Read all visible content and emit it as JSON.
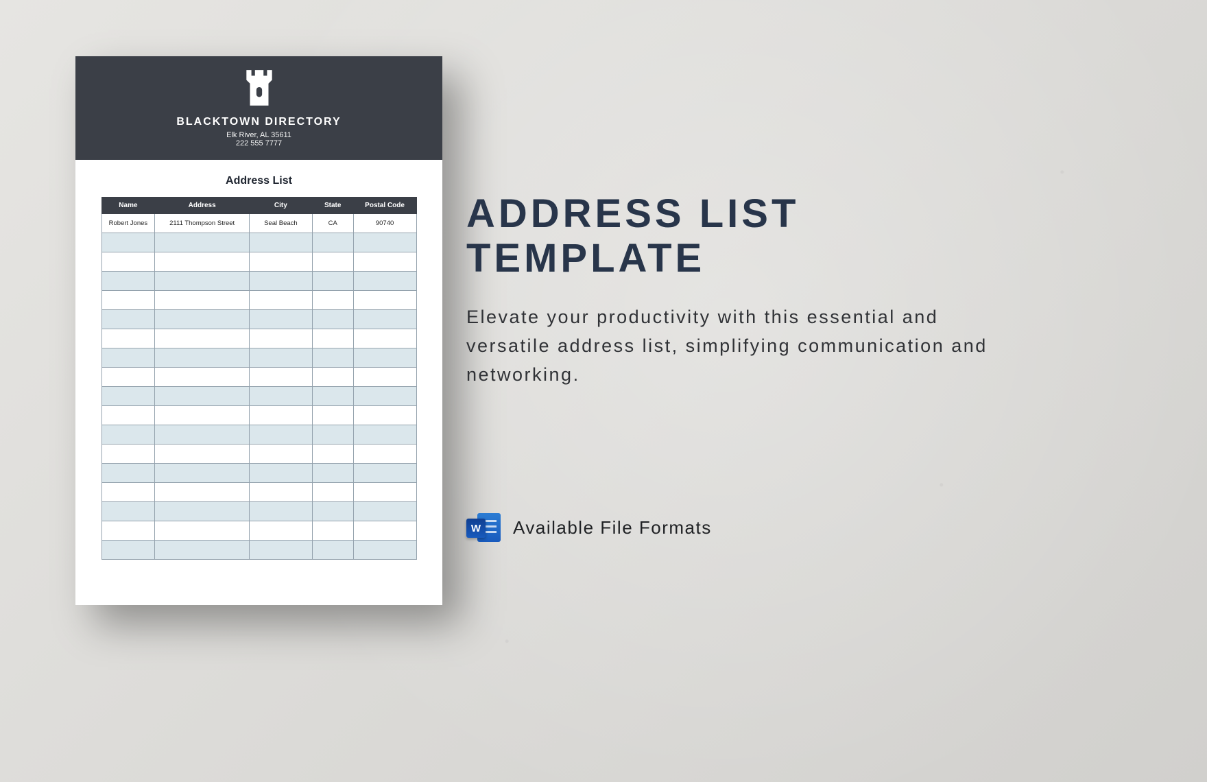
{
  "document": {
    "company": "BLACKTOWN DIRECTORY",
    "location": "Elk River, AL 35611",
    "phone": "222 555 7777",
    "list_title": "Address List",
    "columns": [
      "Name",
      "Address",
      "City",
      "State",
      "Postal Code"
    ],
    "rows": [
      {
        "name": "Robert Jones",
        "address": "2111 Thompson Street",
        "city": "Seal Beach",
        "state": "CA",
        "postal": "90740"
      }
    ],
    "empty_row_count": 17,
    "colors": {
      "header_bg": "#3b3f47",
      "row_alt_bg": "#dbe7ec",
      "border": "#94a2ad"
    }
  },
  "marketing": {
    "title_line1": "ADDRESS LIST",
    "title_line2": "TEMPLATE",
    "description": "Elevate your productivity with this essential and versatile address list, simplifying communication and networking."
  },
  "formats": {
    "label": "Available File Formats",
    "icon_letter": "W",
    "icon_name": "word-icon"
  }
}
